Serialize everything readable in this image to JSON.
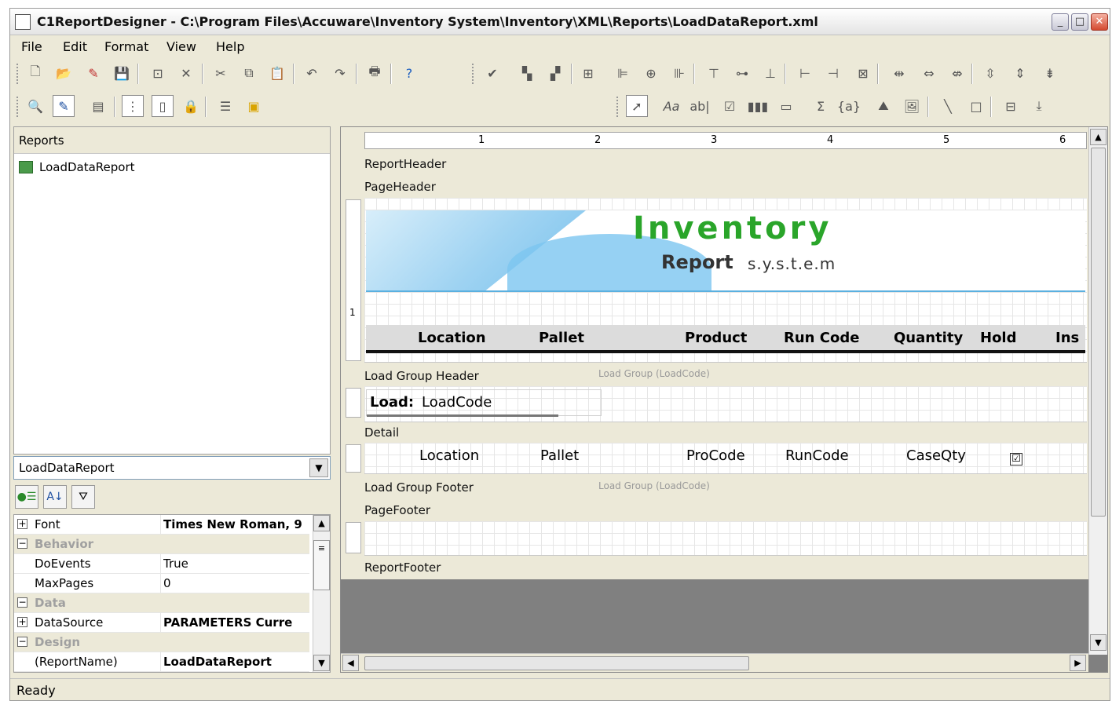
{
  "window": {
    "title": "C1ReportDesigner - C:\\Program Files\\Accuware\\Inventory System\\Inventory\\XML\\Reports\\LoadDataReport.xml",
    "controls": [
      "_",
      "□",
      "✕"
    ]
  },
  "menu": [
    "File",
    "Edit",
    "Format",
    "View",
    "Help"
  ],
  "reports_panel": {
    "header": "Reports",
    "items": [
      "LoadDataReport"
    ]
  },
  "object_selector": {
    "value": "LoadDataReport"
  },
  "properties": [
    {
      "type": "expandable",
      "expander": "+",
      "name": "Font",
      "value": "Times New Roman, 9",
      "bold": true
    },
    {
      "type": "category",
      "expander": "−",
      "name": "Behavior"
    },
    {
      "type": "prop",
      "name": "DoEvents",
      "value": "True"
    },
    {
      "type": "prop",
      "name": "MaxPages",
      "value": "0"
    },
    {
      "type": "category",
      "expander": "−",
      "name": "Data"
    },
    {
      "type": "expandable",
      "expander": "+",
      "name": "DataSource",
      "value": "PARAMETERS Curre",
      "bold": true
    },
    {
      "type": "category",
      "expander": "−",
      "name": "Design"
    },
    {
      "type": "prop",
      "name": "(ReportName)",
      "value": "LoadDataReport",
      "bold": true
    }
  ],
  "ruler": [
    "1",
    "2",
    "3",
    "4",
    "5",
    "6"
  ],
  "vertical_ruler": "1",
  "bands": {
    "report_header": "ReportHeader",
    "page_header": "PageHeader",
    "load_group_header": "Load Group Header",
    "load_group_header_note": "Load Group (LoadCode)",
    "detail": "Detail",
    "load_group_footer": "Load Group Footer",
    "load_group_footer_note": "Load Group (LoadCode)",
    "page_footer": "PageFooter",
    "report_footer": "ReportFooter"
  },
  "banner": {
    "title": "Inventory",
    "subtitle": "Report",
    "subtitle2": "s.y.s.t.e.m"
  },
  "column_headers": [
    "Location",
    "Pallet",
    "Product",
    "Run Code",
    "Quantity",
    "Hold",
    "Ins"
  ],
  "group_field": {
    "label": "Load:",
    "field": "LoadCode"
  },
  "detail_fields": [
    "Location",
    "Pallet",
    "ProCode",
    "RunCode",
    "CaseQty"
  ],
  "detail_checkbox": "☑",
  "status": "Ready"
}
